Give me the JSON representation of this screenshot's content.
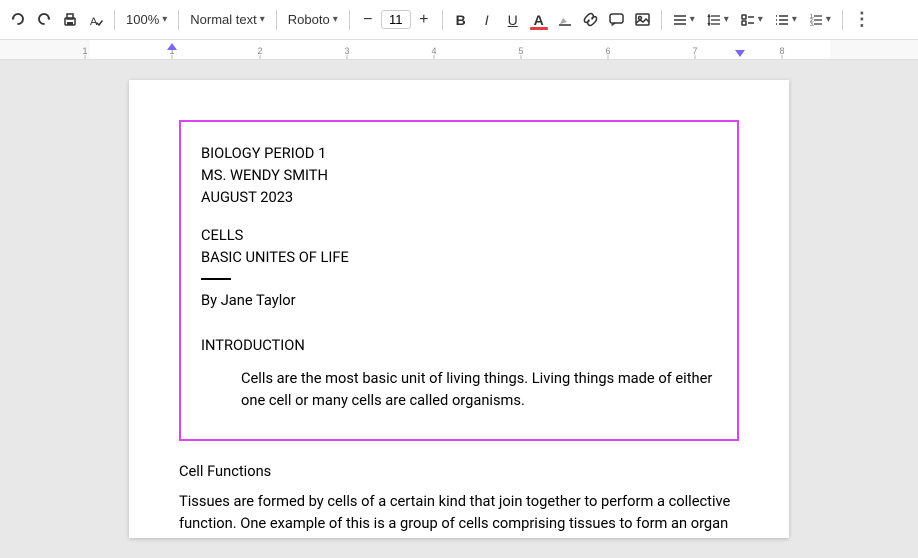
{
  "toolbar": {
    "zoom_label": "100%",
    "zoom_chevron": "▾",
    "style_label": "Normal text",
    "style_chevron": "▾",
    "font_label": "Roboto",
    "font_chevron": "▾",
    "font_size": "11",
    "bold_label": "B",
    "italic_label": "I",
    "underline_label": "U",
    "font_color_label": "A",
    "highlight_label": "✏",
    "link_label": "🔗",
    "comment_label": "💬",
    "image_label": "🖼",
    "align_label": "≡",
    "align_chevron": "▾",
    "line_spacing_label": "↕",
    "line_spacing_chevron": "▾",
    "checklist_label": "✓≡",
    "checklist_chevron": "▾",
    "list_label": "☰",
    "list_chevron": "▾",
    "more_label": "⋮"
  },
  "ruler": {
    "marks": [
      1,
      2,
      3,
      4,
      5,
      6,
      7
    ]
  },
  "document": {
    "selected_block": {
      "line1": "BIOLOGY PERIOD 1",
      "line2": "MS. WENDY SMITH",
      "line3": "AUGUST 2023",
      "title1": "CELLS",
      "title2": "BASIC UNITES OF LIFE",
      "author_prefix": "By ",
      "author_name": "Jane Taylor",
      "section_title": "INTRODUCTION",
      "body_para": "Cells are the most basic unit of living things. Living things made of either one cell or many cells are called organisms."
    },
    "cell_functions_heading": "Cell Functions",
    "tissues_para": "Tissues are formed by cells of a certain kind that join together to perform a collective function. One example of this is a group of cells comprising tissues to form an organ"
  }
}
